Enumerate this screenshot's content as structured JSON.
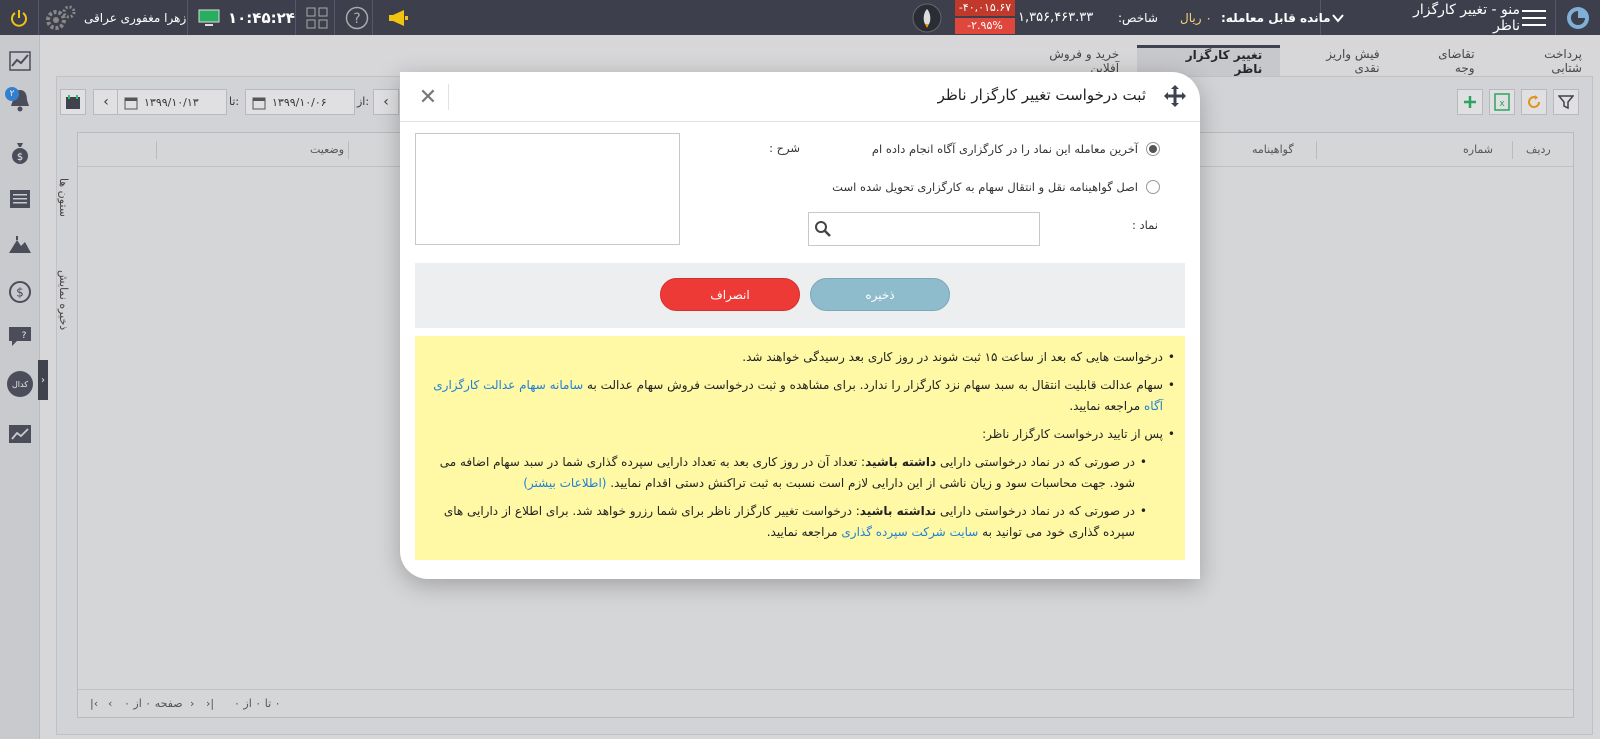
{
  "topbar": {
    "menu_label": "منو - تغییر کارگزار ناظر",
    "balance_label": "مانده قابل معامله:",
    "balance_value": "۰ ریال",
    "index_label": "شاخص:",
    "index_value": "۱,۳۵۶,۴۶۳.۳۳",
    "index_change": "-۴۰,۰۱۵.۶۷",
    "index_percent": "-۲.۹۵%",
    "clock": "۱۰:۴۵:۲۴",
    "user_name": "زهرا مغفوری عراقی",
    "notifications_count": "۲"
  },
  "tabs": [
    {
      "label": "پرداخت شتابی",
      "active": false
    },
    {
      "label": "تقاضای وجه",
      "active": false
    },
    {
      "label": "فیش واریز نقدی",
      "active": false
    },
    {
      "label": "تغییر کارگزار ناظر",
      "active": true
    },
    {
      "label": "خرید و فروش آفلاین",
      "active": false
    }
  ],
  "filters": {
    "from_label": "از:",
    "from_date": "۱۳۹۹/۱۰/۰۶",
    "to_label": "تا:",
    "to_date": "۱۳۹۹/۱۰/۱۳"
  },
  "grid": {
    "columns": [
      "ردیف",
      "شماره",
      "گواهینامه",
      "وضعیت"
    ],
    "side_columns": "ستون ها",
    "side_save": "ذخیره نمایش",
    "footer_count": "۰ تا ۰ از ۰",
    "footer_page": "صفحه ۰ از ۰"
  },
  "sidebar": {
    "codal_label": "کدال"
  },
  "modal": {
    "title": "ثبت درخواست تغییر کارگزار ناظر",
    "radio_1": "آخرین معامله این نماد را در کارگزاری آگاه انجام داده ام",
    "radio_2": "اصل گواهینامه نقل و انتقال سهام به کارگزاری تحویل شده است",
    "description_label": "شرح :",
    "symbol_label": "نماد :",
    "save_button": "ذخیره",
    "cancel_button": "انصراف",
    "notes": {
      "n1": "درخواست هایی که بعد از ساعت ۱۵ ثبت شوند در روز کاری بعد رسیدگی خواهند شد.",
      "n2_a": "سهام عدالت قابلیت انتقال به سبد سهام نزد کارگزار را ندارد. برای مشاهده و ثبت درخواست فروش سهام عدالت به",
      "n2_link": "سامانه سهام عدالت کارگزاری آگاه",
      "n2_b": "مراجعه نمایید.",
      "n3": "پس از تایید درخواست کارگزار ناظر:",
      "n4_a": "در صورتی که در نماد درخواستی دارایی",
      "n4_bold": "داشته باشید",
      "n4_b": ": تعداد آن در روز کاری بعد به تعداد دارایی سپرده گذاری شما در سبد سهام اضافه می شود. جهت محاسبات سود و زیان ناشی از این دارایی لازم است نسبت به ثبت تراکنش دستی اقدام نمایید.",
      "n4_link": "(اطلاعات بیشتر)",
      "n5_a": "در صورتی که در نماد درخواستی دارایی",
      "n5_bold": "نداشته باشید",
      "n5_b": ": درخواست تغییر کارگزار ناظر برای شما رزرو خواهد شد. برای اطلاع از دارایی های سپرده گذاری خود می توانید به",
      "n5_link": "سایت شرکت سپرده گذاری",
      "n5_c": "مراجعه نمایید."
    }
  },
  "colors": {
    "topbar_bg": "#3d3f4c",
    "save_btn": "#8fbccc",
    "cancel_btn": "#ed3a36",
    "notes_bg": "#fff9a6",
    "link": "#1f7fd6",
    "index_negative": "#e0473c"
  }
}
